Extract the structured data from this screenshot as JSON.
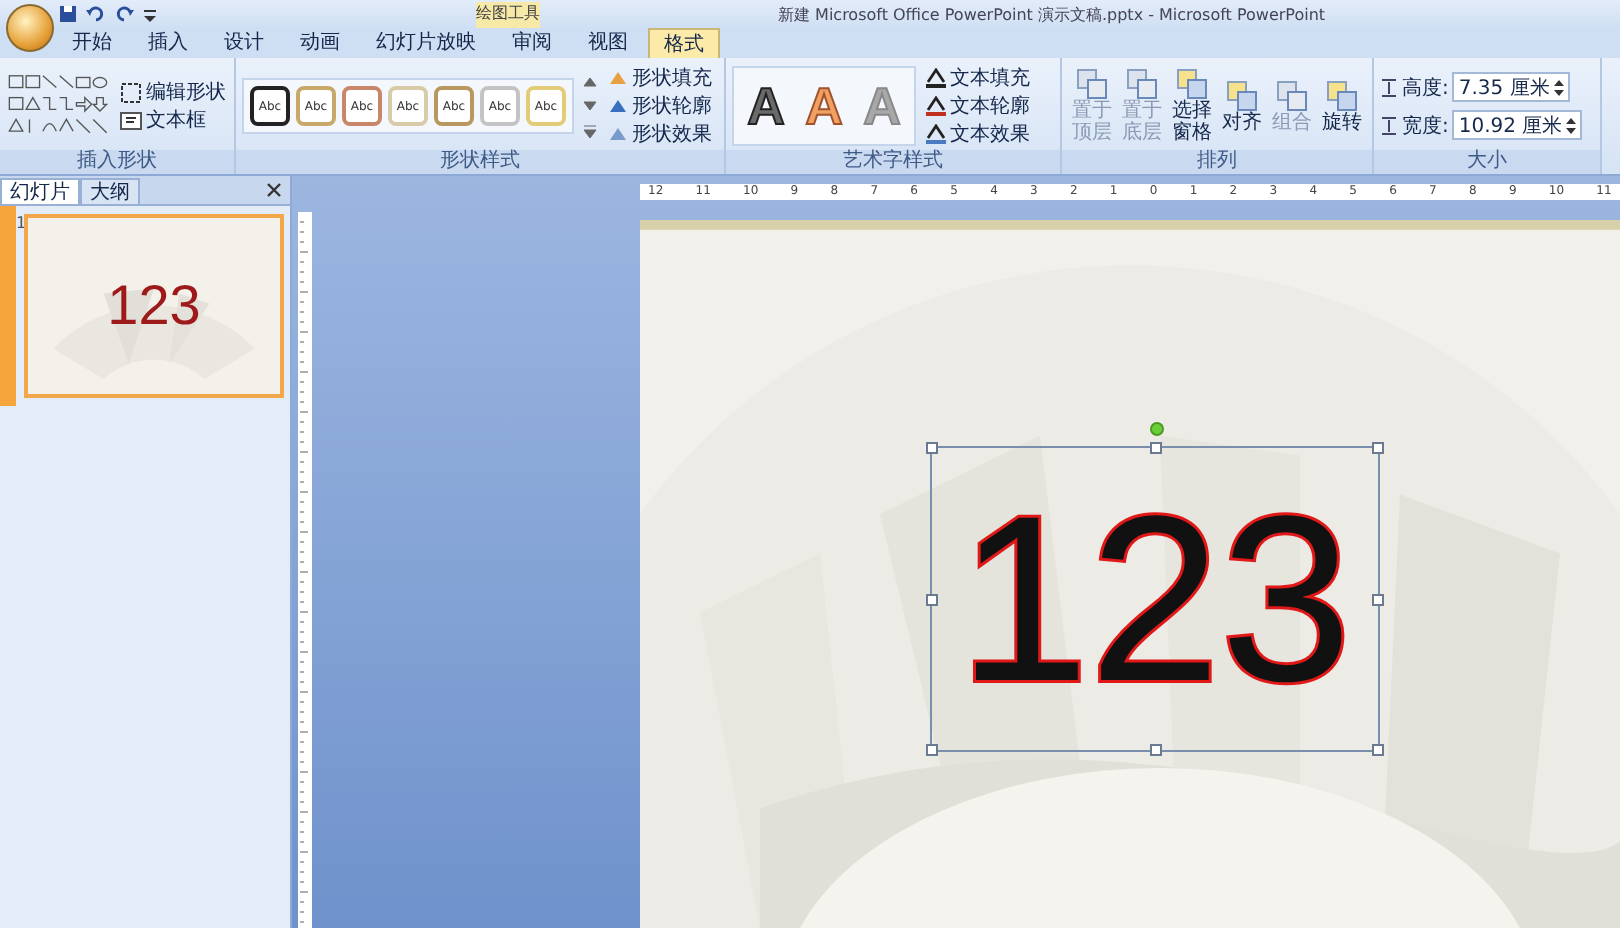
{
  "window": {
    "title": "新建 Microsoft Office PowerPoint 演示文稿.pptx - Microsoft PowerPoint",
    "context_label": "绘图工具"
  },
  "tabs": [
    {
      "label": "开始",
      "selected": false
    },
    {
      "label": "插入",
      "selected": false
    },
    {
      "label": "设计",
      "selected": false
    },
    {
      "label": "动画",
      "selected": false
    },
    {
      "label": "幻灯片放映",
      "selected": false
    },
    {
      "label": "审阅",
      "selected": false
    },
    {
      "label": "视图",
      "selected": false
    },
    {
      "label": "格式",
      "selected": true
    }
  ],
  "ribbon": {
    "insert_shapes": {
      "label": "插入形状",
      "buttons": [
        "编辑形状",
        "文本框"
      ]
    },
    "shape_styles": {
      "label": "形状样式",
      "swatches": [
        {
          "text": "Abc",
          "color": "#222222"
        },
        {
          "text": "Abc",
          "color": "#c8a96a"
        },
        {
          "text": "Abc",
          "color": "#c8866a"
        },
        {
          "text": "Abc",
          "color": "#d8cca8"
        },
        {
          "text": "Abc",
          "color": "#b8985e"
        },
        {
          "text": "Abc",
          "color": "#c4c4c4"
        },
        {
          "text": "Abc",
          "color": "#e2cc78"
        }
      ],
      "buttons": [
        "形状填充",
        "形状轮廓",
        "形状效果"
      ]
    },
    "wordart_styles": {
      "label": "艺术字样式",
      "samples": [
        {
          "text": "A",
          "kind": "outline"
        },
        {
          "text": "A",
          "kind": "orange"
        },
        {
          "text": "A",
          "kind": "light"
        }
      ],
      "buttons": [
        "文本填充",
        "文本轮廓",
        "文本效果"
      ]
    },
    "arrange": {
      "label": "排列",
      "buttons": [
        {
          "label": "置于顶层",
          "disabled": true
        },
        {
          "label": "置于底层",
          "disabled": true
        },
        {
          "label": "选择窗格",
          "disabled": false
        },
        {
          "label": "对齐",
          "disabled": false
        },
        {
          "label": "组合",
          "disabled": true
        },
        {
          "label": "旋转",
          "disabled": false
        }
      ]
    },
    "size": {
      "label": "大小",
      "fields": [
        {
          "label": "高度:",
          "value": "7.35 厘米"
        },
        {
          "label": "宽度:",
          "value": "10.92 厘米"
        }
      ]
    }
  },
  "slides_panel": {
    "tabs": [
      {
        "label": "幻灯片",
        "selected": true
      },
      {
        "label": "大纲",
        "selected": false
      }
    ],
    "slides": [
      {
        "number": "1",
        "text": "123",
        "selected": true
      }
    ]
  },
  "ruler": {
    "labels": [
      "12",
      "11",
      "10",
      "9",
      "8",
      "7",
      "6",
      "5",
      "4",
      "3",
      "2",
      "1",
      "0",
      "1",
      "2",
      "3",
      "4",
      "5",
      "6",
      "7",
      "8",
      "9",
      "10",
      "11"
    ]
  },
  "slide": {
    "text": "123",
    "text_box_selected": true
  }
}
